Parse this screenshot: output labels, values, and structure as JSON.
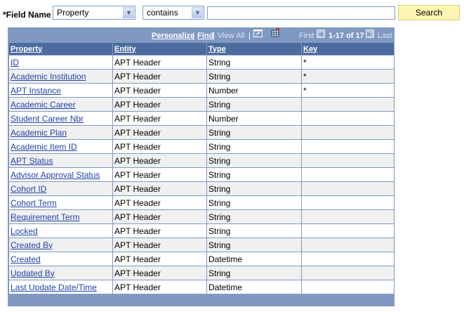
{
  "search": {
    "field_label": "*Field Name",
    "field_select": "Property",
    "operator_select": "contains",
    "value": "",
    "button": "Search"
  },
  "navbar": {
    "personalize": "Personalize",
    "sep1": "|",
    "find": "Find",
    "sep2": "|",
    "view_all": "View All",
    "sep3": "|",
    "first": "First",
    "range": "1-17 of 17",
    "last": "Last",
    "icons": [
      "zoom-window-icon",
      "grid-download-icon",
      "prev-arrow-icon",
      "next-arrow-icon"
    ]
  },
  "table": {
    "headers": [
      "Property",
      "Entity",
      "Type",
      "Key"
    ],
    "rows": [
      {
        "property": "ID",
        "entity": "APT Header",
        "type": "String",
        "key": "*"
      },
      {
        "property": "Academic Institution",
        "entity": "APT Header",
        "type": "String",
        "key": "*"
      },
      {
        "property": "APT Instance",
        "entity": "APT Header",
        "type": "Number",
        "key": "*"
      },
      {
        "property": "Academic Career",
        "entity": "APT Header",
        "type": "String",
        "key": ""
      },
      {
        "property": "Student Career Nbr",
        "entity": "APT Header",
        "type": "Number",
        "key": ""
      },
      {
        "property": "Academic Plan",
        "entity": "APT Header",
        "type": "String",
        "key": ""
      },
      {
        "property": "Academic Item ID",
        "entity": "APT Header",
        "type": "String",
        "key": ""
      },
      {
        "property": "APT Status",
        "entity": "APT Header",
        "type": "String",
        "key": ""
      },
      {
        "property": "Advisor Approval Status",
        "entity": "APT Header",
        "type": "String",
        "key": ""
      },
      {
        "property": "Cohort ID",
        "entity": "APT Header",
        "type": "String",
        "key": ""
      },
      {
        "property": "Cohort Term",
        "entity": "APT Header",
        "type": "String",
        "key": ""
      },
      {
        "property": "Requirement Term",
        "entity": "APT Header",
        "type": "String",
        "key": ""
      },
      {
        "property": "Locked",
        "entity": "APT Header",
        "type": "String",
        "key": ""
      },
      {
        "property": "Created By",
        "entity": "APT Header",
        "type": "String",
        "key": ""
      },
      {
        "property": "Created",
        "entity": "APT Header",
        "type": "Datetime",
        "key": ""
      },
      {
        "property": "Updated By",
        "entity": "APT Header",
        "type": "String",
        "key": ""
      },
      {
        "property": "Last Update Date/Time",
        "entity": "APT Header",
        "type": "Datetime",
        "key": ""
      }
    ]
  },
  "colors": {
    "grid_border": "#8099c2",
    "header_bg": "#4c6b9f",
    "link": "#1f43a8",
    "search_button": "#fcf5b2"
  }
}
